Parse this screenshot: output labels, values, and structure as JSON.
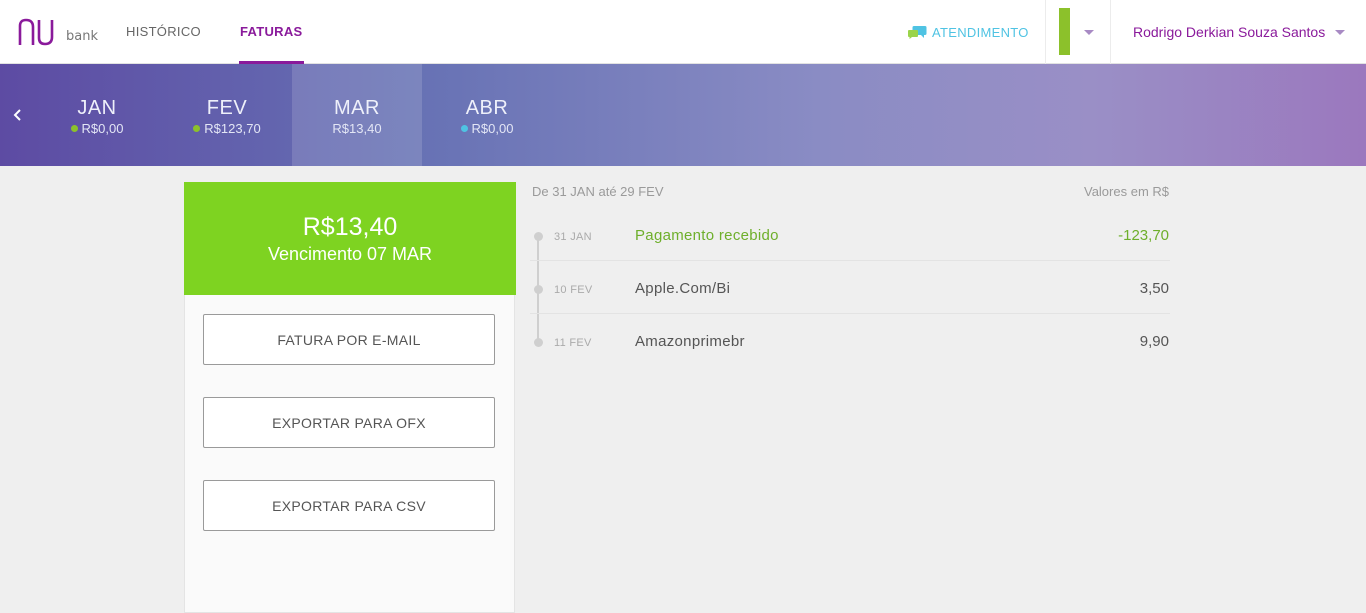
{
  "header": {
    "logo_text": "bank",
    "nav": [
      {
        "label": "HISTÓRICO",
        "active": false
      },
      {
        "label": "FATURAS",
        "active": true
      }
    ],
    "support_label": "ATENDIMENTO",
    "user_name": "Rodrigo Derkian Souza Santos",
    "colors": {
      "brand_purple": "#8a1a9b",
      "support_blue": "#4fc3e3",
      "account_green": "#8cc12b"
    }
  },
  "months": [
    {
      "name": "JAN",
      "amount": "R$0,00",
      "dot_color": "#8cc12b",
      "active": false
    },
    {
      "name": "FEV",
      "amount": "R$123,70",
      "dot_color": "#8cc12b",
      "active": false
    },
    {
      "name": "MAR",
      "amount": "R$13,40",
      "dot_color": "",
      "active": true
    },
    {
      "name": "ABR",
      "amount": "R$0,00",
      "dot_color": "#4fc3e3",
      "active": false
    }
  ],
  "invoice": {
    "total": "R$13,40",
    "due": "Vencimento 07 MAR",
    "header_color": "#7ed321",
    "buttons": [
      "FATURA POR E-MAIL",
      "EXPORTAR PARA OFX",
      "EXPORTAR PARA CSV"
    ]
  },
  "transactions": {
    "period": "De 31 JAN até 29 FEV",
    "currency_note": "Valores em R$",
    "items": [
      {
        "date": "31 JAN",
        "description": "Pagamento recebido",
        "value": "-123,70",
        "positive": true
      },
      {
        "date": "10 FEV",
        "description": "Apple.Com/Bi",
        "value": "3,50",
        "positive": false
      },
      {
        "date": "11 FEV",
        "description": "Amazonprimebr",
        "value": "9,90",
        "positive": false
      }
    ]
  },
  "icons": {
    "logo": "nubank-logo-icon",
    "support": "chat-bubbles-icon",
    "prev": "chevron-left-icon",
    "dropdown": "chevron-down-icon"
  }
}
